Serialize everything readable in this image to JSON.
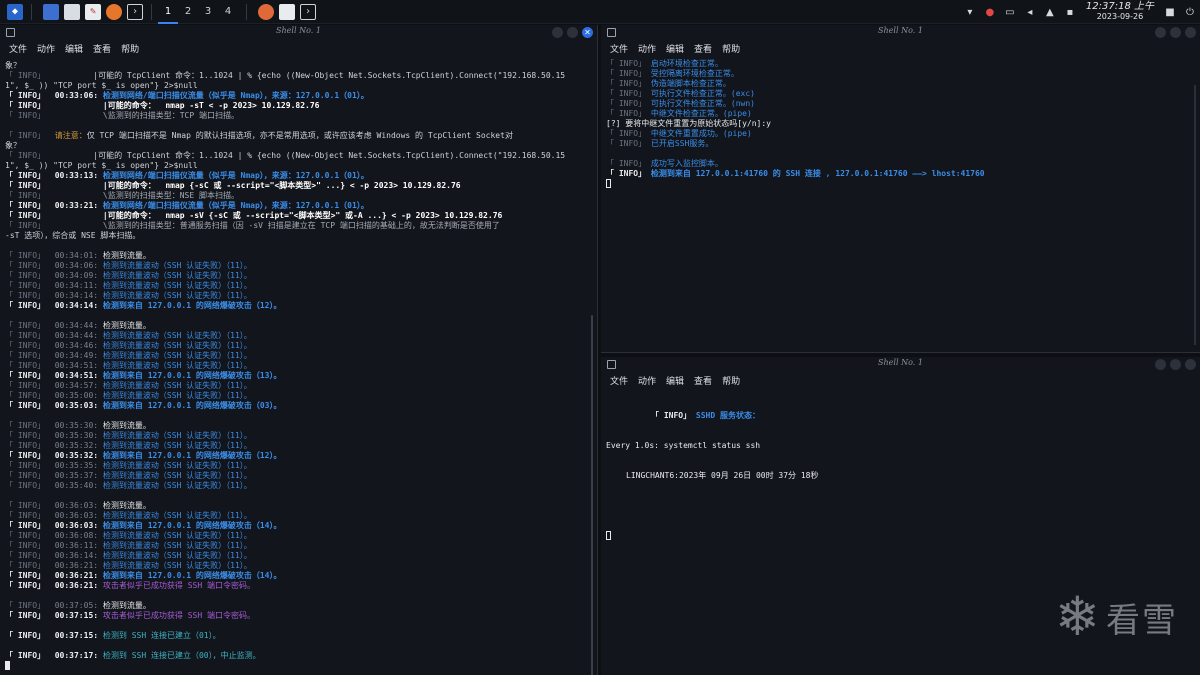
{
  "taskbar": {
    "workspaces": [
      "1",
      "2",
      "3",
      "4"
    ],
    "clock_time": "12:37:18 上午",
    "clock_date": "2023-09-26",
    "icons": [
      "kali-menu-icon",
      "desktop-icon",
      "files-icon",
      "text-editor-icon",
      "firefox-icon",
      "terminal-icon",
      "burp-icon",
      "document-icon",
      "terminal-badge-icon"
    ],
    "tray": [
      "network-icon",
      "user-icon",
      "keyboard-icon",
      "volume-icon",
      "notification-icon",
      "battery-icon",
      "lock-icon",
      "power-icon"
    ],
    "accent": "#3b82f6"
  },
  "windows": {
    "left": {
      "title": "Shell No. 1",
      "menu": [
        "文件",
        "动作",
        "编辑",
        "查看",
        "帮助"
      ]
    },
    "right_top": {
      "title": "Shell No. 1",
      "menu": [
        "文件",
        "动作",
        "编辑",
        "查看",
        "帮助"
      ]
    },
    "right_bottom": {
      "title": "Shell No. 1",
      "menu": [
        "文件",
        "动作",
        "编辑",
        "查看",
        "帮助"
      ]
    }
  },
  "left_lines": [
    [
      {
        "c": "lb",
        "t": "象？"
      }
    ],
    [
      {
        "c": "tag",
        "t": "「 INFO」"
      },
      {
        "c": "lb",
        "t": "          |可能的 TcpClient 命令：1..1024 | % {echo ((New-Object Net.Sockets.TcpClient).Connect(\"192.168.50.15"
      }
    ],
    [
      {
        "c": "lb",
        "t": "1\", $_ )) \"TCP port $_ is open\"} 2>$null"
      }
    ],
    [
      {
        "c": "tagb",
        "t": "「 INFO」"
      },
      {
        "c": "tsb",
        "t": "  00:33:06: "
      },
      {
        "c": "blueb",
        "t": "检测到网络/端口扫描仪流量（似乎是 Nmap），来源：127.0.0.1（01）。"
      }
    ],
    [
      {
        "c": "tagb",
        "t": "「 INFO」"
      },
      {
        "c": "whiteb",
        "t": "            |可能的命令：  nmap -sT < -p 2023> 10.129.82.76"
      }
    ],
    [
      {
        "c": "tag",
        "t": "「 INFO」"
      },
      {
        "c": "dim",
        "t": "            \\监测到的扫描类型：TCP 端口扫描。"
      }
    ],
    [
      {
        "c": "lb",
        "t": " "
      }
    ],
    [
      {
        "c": "tag",
        "t": "「 INFO」"
      },
      {
        "c": "orange",
        "t": "  请注意："
      },
      {
        "c": "lb",
        "t": "仅 TCP 端口扫描不是 Nmap 的默认扫描选项，亦不是常用选项，或许应该考虑 Windows 的 TcpClient Socket对"
      }
    ],
    [
      {
        "c": "lb",
        "t": "象？"
      }
    ],
    [
      {
        "c": "tag",
        "t": "「 INFO」"
      },
      {
        "c": "lb",
        "t": "          |可能的 TcpClient 命令：1..1024 | % {echo ((New-Object Net.Sockets.TcpClient).Connect(\"192.168.50.15"
      }
    ],
    [
      {
        "c": "lb",
        "t": "1\", $_ )) \"TCP port $_ is open\"} 2>$null"
      }
    ],
    [
      {
        "c": "tagb",
        "t": "「 INFO」"
      },
      {
        "c": "tsb",
        "t": "  00:33:13: "
      },
      {
        "c": "blueb",
        "t": "检测到网络/端口扫描仪流量（似乎是 Nmap），来源：127.0.0.1（01）。"
      }
    ],
    [
      {
        "c": "tagb",
        "t": "「 INFO」"
      },
      {
        "c": "whiteb",
        "t": "            |可能的命令：  nmap {-sC 或 --script=\"<脚本类型>\" ...} < -p 2023> 10.129.82.76"
      }
    ],
    [
      {
        "c": "tag",
        "t": "「 INFO」"
      },
      {
        "c": "dim",
        "t": "            \\监测到的扫描类型：NSE 脚本扫描。"
      }
    ],
    [
      {
        "c": "tagb",
        "t": "「 INFO」"
      },
      {
        "c": "tsb",
        "t": "  00:33:21: "
      },
      {
        "c": "blueb",
        "t": "检测到网络/端口扫描仪流量（似乎是 Nmap），来源：127.0.0.1（01）。"
      }
    ],
    [
      {
        "c": "tagb",
        "t": "「 INFO」"
      },
      {
        "c": "whiteb",
        "t": "            |可能的命令：  nmap -sV {-sC 或 --script=\"<脚本类型>\" 或-A ...} < -p 2023> 10.129.82.76"
      }
    ],
    [
      {
        "c": "tag",
        "t": "「 INFO」"
      },
      {
        "c": "dim",
        "t": "            \\监测到的扫描类型：普通服务扫描（因 -sV 扫描是建立在 TCP 端口扫描的基础上的，故无法判断是否使用了"
      }
    ],
    [
      {
        "c": "lb",
        "t": "-sT 选项），综合或 NSE 脚本扫描。"
      }
    ],
    [
      {
        "c": "lb",
        "t": " "
      }
    ],
    [
      {
        "c": "tag",
        "t": "「 INFO」"
      },
      {
        "c": "ts",
        "t": "  00:34:01: "
      },
      {
        "c": "white",
        "t": "检测到流量。"
      }
    ],
    [
      {
        "c": "tag",
        "t": "「 INFO」"
      },
      {
        "c": "ts",
        "t": "  00:34:06: "
      },
      {
        "c": "blue",
        "t": "检测到流量波动（SSH 认证失败）（11）。"
      }
    ],
    [
      {
        "c": "tag",
        "t": "「 INFO」"
      },
      {
        "c": "ts",
        "t": "  00:34:09: "
      },
      {
        "c": "blue",
        "t": "检测到流量波动（SSH 认证失败）（11）。"
      }
    ],
    [
      {
        "c": "tag",
        "t": "「 INFO」"
      },
      {
        "c": "ts",
        "t": "  00:34:11: "
      },
      {
        "c": "blue",
        "t": "检测到流量波动（SSH 认证失败）（11）。"
      }
    ],
    [
      {
        "c": "tag",
        "t": "「 INFO」"
      },
      {
        "c": "ts",
        "t": "  00:34:14: "
      },
      {
        "c": "blue",
        "t": "检测到流量波动（SSH 认证失败）（11）。"
      }
    ],
    [
      {
        "c": "tagb",
        "t": "「 INFO」"
      },
      {
        "c": "tsb",
        "t": "  00:34:14: "
      },
      {
        "c": "blueb",
        "t": "检测到来自 127.0.0.1 的网络爆破攻击（12）。"
      }
    ],
    [
      {
        "c": "lb",
        "t": " "
      }
    ],
    [
      {
        "c": "tag",
        "t": "「 INFO」"
      },
      {
        "c": "ts",
        "t": "  00:34:44: "
      },
      {
        "c": "white",
        "t": "检测到流量。"
      }
    ],
    [
      {
        "c": "tag",
        "t": "「 INFO」"
      },
      {
        "c": "ts",
        "t": "  00:34:44: "
      },
      {
        "c": "blue",
        "t": "检测到流量波动（SSH 认证失败）（11）。"
      }
    ],
    [
      {
        "c": "tag",
        "t": "「 INFO」"
      },
      {
        "c": "ts",
        "t": "  00:34:46: "
      },
      {
        "c": "blue",
        "t": "检测到流量波动（SSH 认证失败）（11）。"
      }
    ],
    [
      {
        "c": "tag",
        "t": "「 INFO」"
      },
      {
        "c": "ts",
        "t": "  00:34:49: "
      },
      {
        "c": "blue",
        "t": "检测到流量波动（SSH 认证失败）（11）。"
      }
    ],
    [
      {
        "c": "tag",
        "t": "「 INFO」"
      },
      {
        "c": "ts",
        "t": "  00:34:51: "
      },
      {
        "c": "blue",
        "t": "检测到流量波动（SSH 认证失败）（11）。"
      }
    ],
    [
      {
        "c": "tagb",
        "t": "「 INFO」"
      },
      {
        "c": "tsb",
        "t": "  00:34:51: "
      },
      {
        "c": "blueb",
        "t": "检测到来自 127.0.0.1 的网络爆破攻击（13）。"
      }
    ],
    [
      {
        "c": "tag",
        "t": "「 INFO」"
      },
      {
        "c": "ts",
        "t": "  00:34:57: "
      },
      {
        "c": "blue",
        "t": "检测到流量波动（SSH 认证失败）（11）。"
      }
    ],
    [
      {
        "c": "tag",
        "t": "「 INFO」"
      },
      {
        "c": "ts",
        "t": "  00:35:00: "
      },
      {
        "c": "blue",
        "t": "检测到流量波动（SSH 认证失败）（11）。"
      }
    ],
    [
      {
        "c": "tagb",
        "t": "「 INFO」"
      },
      {
        "c": "tsb",
        "t": "  00:35:03: "
      },
      {
        "c": "blueb",
        "t": "检测到来自 127.0.0.1 的网络爆破攻击（03）。"
      }
    ],
    [
      {
        "c": "lb",
        "t": " "
      }
    ],
    [
      {
        "c": "tag",
        "t": "「 INFO」"
      },
      {
        "c": "ts",
        "t": "  00:35:30: "
      },
      {
        "c": "white",
        "t": "检测到流量。"
      }
    ],
    [
      {
        "c": "tag",
        "t": "「 INFO」"
      },
      {
        "c": "ts",
        "t": "  00:35:30: "
      },
      {
        "c": "blue",
        "t": "检测到流量波动（SSH 认证失败）（11）。"
      }
    ],
    [
      {
        "c": "tag",
        "t": "「 INFO」"
      },
      {
        "c": "ts",
        "t": "  00:35:32: "
      },
      {
        "c": "blue",
        "t": "检测到流量波动（SSH 认证失败）（11）。"
      }
    ],
    [
      {
        "c": "tagb",
        "t": "「 INFO」"
      },
      {
        "c": "tsb",
        "t": "  00:35:32: "
      },
      {
        "c": "blueb",
        "t": "检测到来自 127.0.0.1 的网络爆破攻击（12）。"
      }
    ],
    [
      {
        "c": "tag",
        "t": "「 INFO」"
      },
      {
        "c": "ts",
        "t": "  00:35:35: "
      },
      {
        "c": "blue",
        "t": "检测到流量波动（SSH 认证失败）（11）。"
      }
    ],
    [
      {
        "c": "tag",
        "t": "「 INFO」"
      },
      {
        "c": "ts",
        "t": "  00:35:37: "
      },
      {
        "c": "blue",
        "t": "检测到流量波动（SSH 认证失败）（11）。"
      }
    ],
    [
      {
        "c": "tag",
        "t": "「 INFO」"
      },
      {
        "c": "ts",
        "t": "  00:35:40: "
      },
      {
        "c": "blue",
        "t": "检测到流量波动（SSH 认证失败）（11）。"
      }
    ],
    [
      {
        "c": "lb",
        "t": " "
      }
    ],
    [
      {
        "c": "tag",
        "t": "「 INFO」"
      },
      {
        "c": "ts",
        "t": "  00:36:03: "
      },
      {
        "c": "white",
        "t": "检测到流量。"
      }
    ],
    [
      {
        "c": "tag",
        "t": "「 INFO」"
      },
      {
        "c": "ts",
        "t": "  00:36:03: "
      },
      {
        "c": "blue",
        "t": "检测到流量波动（SSH 认证失败）（11）。"
      }
    ],
    [
      {
        "c": "tagb",
        "t": "「 INFO」"
      },
      {
        "c": "tsb",
        "t": "  00:36:03: "
      },
      {
        "c": "blueb",
        "t": "检测到来自 127.0.0.1 的网络爆破攻击（14）。"
      }
    ],
    [
      {
        "c": "tag",
        "t": "「 INFO」"
      },
      {
        "c": "ts",
        "t": "  00:36:08: "
      },
      {
        "c": "blue",
        "t": "检测到流量波动（SSH 认证失败）（11）。"
      }
    ],
    [
      {
        "c": "tag",
        "t": "「 INFO」"
      },
      {
        "c": "ts",
        "t": "  00:36:11: "
      },
      {
        "c": "blue",
        "t": "检测到流量波动（SSH 认证失败）（11）。"
      }
    ],
    [
      {
        "c": "tag",
        "t": "「 INFO」"
      },
      {
        "c": "ts",
        "t": "  00:36:14: "
      },
      {
        "c": "blue",
        "t": "检测到流量波动（SSH 认证失败）（11）。"
      }
    ],
    [
      {
        "c": "tag",
        "t": "「 INFO」"
      },
      {
        "c": "ts",
        "t": "  00:36:21: "
      },
      {
        "c": "blue",
        "t": "检测到流量波动（SSH 认证失败）（11）。"
      }
    ],
    [
      {
        "c": "tagb",
        "t": "「 INFO」"
      },
      {
        "c": "tsb",
        "t": "  00:36:21: "
      },
      {
        "c": "blueb",
        "t": "检测到来自 127.0.0.1 的网络爆破攻击（14）。"
      }
    ],
    [
      {
        "c": "tagb",
        "t": "「 INFO」"
      },
      {
        "c": "tsb",
        "t": "  00:36:21: "
      },
      {
        "c": "purple",
        "t": "攻击者似乎已成功获得 SSH 端口令密码。"
      }
    ],
    [
      {
        "c": "lb",
        "t": " "
      }
    ],
    [
      {
        "c": "tag",
        "t": "「 INFO」"
      },
      {
        "c": "ts",
        "t": "  00:37:05: "
      },
      {
        "c": "white",
        "t": "检测到流量。"
      }
    ],
    [
      {
        "c": "tagb",
        "t": "「 INFO」"
      },
      {
        "c": "tsb",
        "t": "  00:37:15: "
      },
      {
        "c": "purple",
        "t": "攻击者似乎已成功获得 SSH 端口令密码。"
      }
    ],
    [
      {
        "c": "lb",
        "t": " "
      }
    ],
    [
      {
        "c": "tagb",
        "t": "「 INFO」"
      },
      {
        "c": "tsb",
        "t": "  00:37:15: "
      },
      {
        "c": "cyan",
        "t": "检测到 SSH 连接已建立（01）。"
      }
    ],
    [
      {
        "c": "lb",
        "t": " "
      }
    ],
    [
      {
        "c": "tagb",
        "t": "「 INFO」"
      },
      {
        "c": "tsb",
        "t": "  00:37:17: "
      },
      {
        "c": "cyan",
        "t": "检测到 SSH 连接已建立（00），中止监测。"
      }
    ]
  ],
  "right_top_lines": [
    [
      {
        "c": "tag",
        "t": "「 INFO」"
      },
      {
        "c": "blue",
        "t": " 启动环境检查正常。"
      }
    ],
    [
      {
        "c": "tag",
        "t": "「 INFO」"
      },
      {
        "c": "blue",
        "t": " 受控隔离环境检查正常。"
      }
    ],
    [
      {
        "c": "tag",
        "t": "「 INFO」"
      },
      {
        "c": "blue",
        "t": " 伪造端脚本检查正常。"
      }
    ],
    [
      {
        "c": "tag",
        "t": "「 INFO」"
      },
      {
        "c": "blue",
        "t": " 可执行文件检查正常。(exc)"
      }
    ],
    [
      {
        "c": "tag",
        "t": "「 INFO」"
      },
      {
        "c": "blue",
        "t": " 可执行文件检查正常。(nwn)"
      }
    ],
    [
      {
        "c": "tag",
        "t": "「 INFO」"
      },
      {
        "c": "blue",
        "t": " 中继文件检查正常。(pipe)"
      }
    ],
    [
      {
        "c": "white",
        "t": "[?] 要将中继文件重置为原始状态吗[y/n]:y"
      }
    ],
    [
      {
        "c": "tag",
        "t": "「 INFO」"
      },
      {
        "c": "blue",
        "t": " 中继文件重置成功。(pipe)"
      }
    ],
    [
      {
        "c": "tag",
        "t": "「 INFO」"
      },
      {
        "c": "blue",
        "t": " 已开启SSH服务。"
      }
    ],
    [
      {
        "c": "lb",
        "t": " "
      }
    ],
    [
      {
        "c": "tag",
        "t": "「 INFO」"
      },
      {
        "c": "blue",
        "t": " 成功写入监控脚本。"
      }
    ],
    [
      {
        "c": "tagb",
        "t": "「 INFO」"
      },
      {
        "c": "blueb",
        "t": " 检测到来自 127.0.0.1:41760 的 SSH 连接 , 127.0.0.1:41760 ——> lhost:41760"
      }
    ]
  ],
  "right_bottom": {
    "header_tag": "「 INFO」",
    "header_text": " SSHD 服务状态：",
    "watch_line": "Every 1.0s: systemctl status ssh",
    "host_line": "LINGCHANT6:2023年 09月 26日 00时 37分 18秒"
  },
  "watermark": {
    "text": "看雪"
  }
}
